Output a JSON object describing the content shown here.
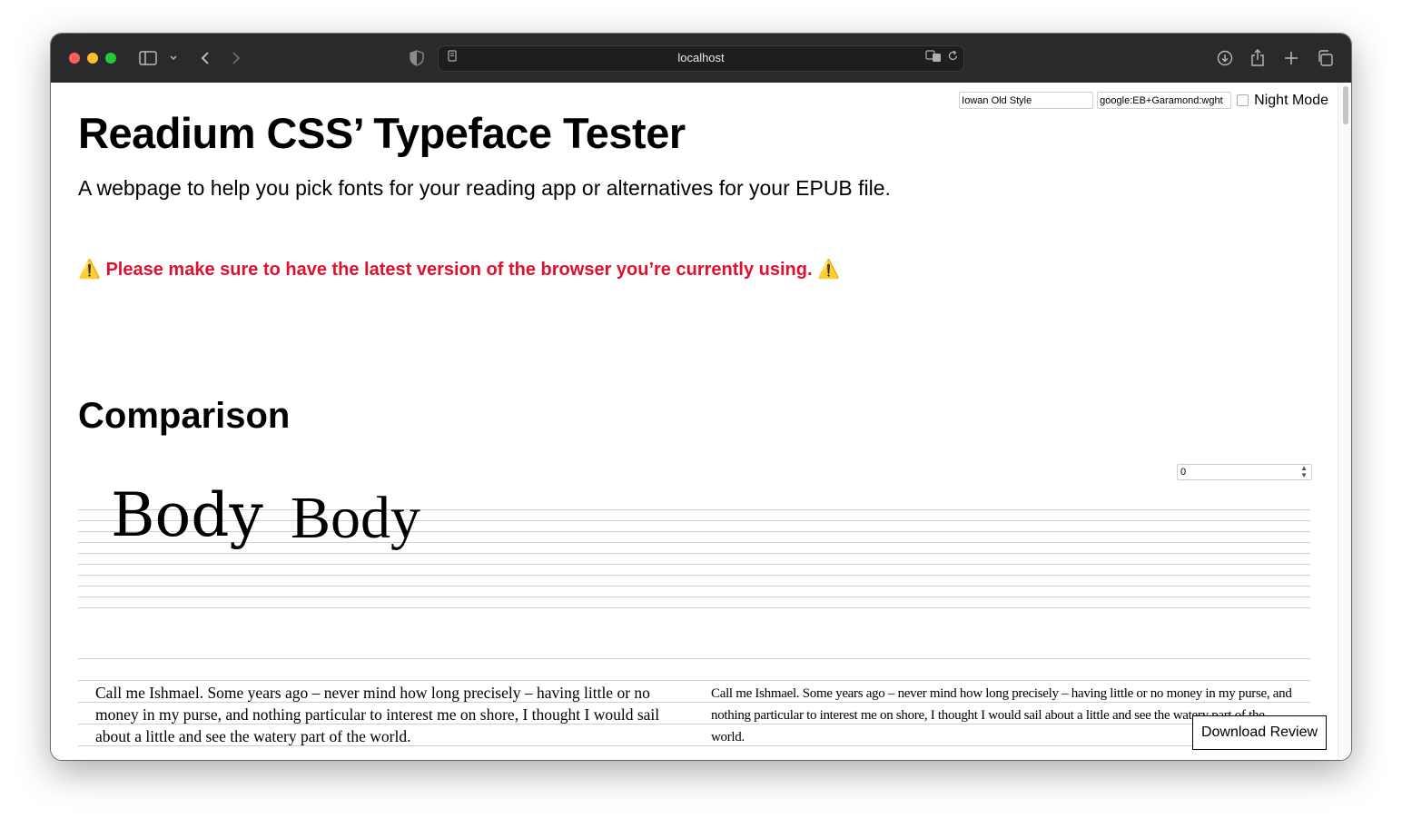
{
  "browser": {
    "url": "localhost"
  },
  "page": {
    "title": "Readium CSS’ Typeface Tester",
    "subtitle": "A webpage to help you pick fonts for your reading app or alternatives for your EPUB file.",
    "warning_icon": "⚠️",
    "warning_text": "Please make sure to have the latest version of the browser you’re currently using.",
    "section_title": "Comparison"
  },
  "controls": {
    "font_a_value": "Iowan Old Style",
    "font_b_value": "google:EB+Garamond:wght",
    "night_mode_label": "Night Mode",
    "night_mode_checked": false,
    "number_value": "0"
  },
  "comparison": {
    "sample_a": "Body",
    "sample_b": "Body",
    "paragraph_a": "Call me Ishmael. Some years ago – never mind how long precisely – having little or no money in my purse, and nothing particular to interest me on shore, I thought I would sail about a little and see the watery part of the world.",
    "paragraph_b": "Call me Ishmael. Some years ago – never mind how long precisely – having little or no money in my purse, and nothing particular to interest me on shore, I thought I would sail about a little and see the watery part of the world."
  },
  "download_label": "Download Review"
}
